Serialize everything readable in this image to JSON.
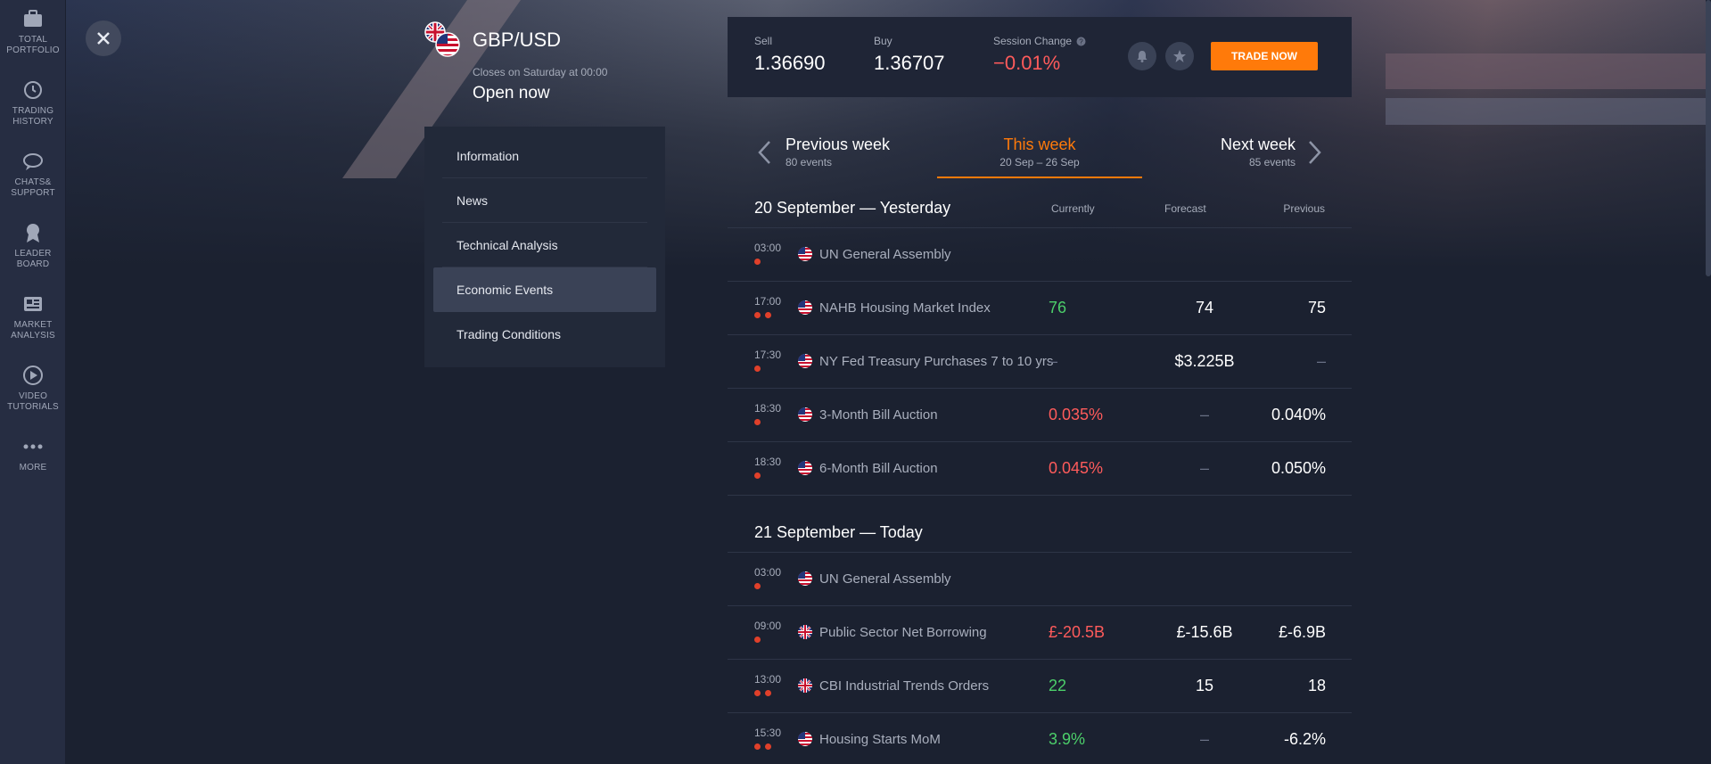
{
  "sidebar": {
    "items": [
      {
        "label": "TOTAL\nPORTFOLIO",
        "icon": "briefcase-icon"
      },
      {
        "label": "TRADING\nHISTORY",
        "icon": "history-icon"
      },
      {
        "label": "CHATS&\nSUPPORT",
        "icon": "chat-icon"
      },
      {
        "label": "LEADER\nBOARD",
        "icon": "medal-icon"
      },
      {
        "label": "MARKET\nANALYSIS",
        "icon": "newspaper-icon"
      },
      {
        "label": "VIDEO\nTUTORIALS",
        "icon": "play-icon"
      },
      {
        "label": "MORE",
        "icon": "more-dots-icon"
      }
    ]
  },
  "asset": {
    "name": "GBP/USD",
    "closes": "Closes on Saturday at 00:00",
    "status": "Open now"
  },
  "prices": {
    "sell_label": "Sell",
    "sell_value": "1.36690",
    "buy_label": "Buy",
    "buy_value": "1.36707",
    "change_label": "Session Change",
    "change_value": "−0.01%",
    "trade_label": "TRADE NOW"
  },
  "menu": {
    "items": [
      "Information",
      "News",
      "Technical Analysis",
      "Economic Events",
      "Trading Conditions"
    ],
    "active": "Economic Events"
  },
  "week_nav": {
    "prev_title": "Previous week",
    "prev_sub": "80 events",
    "this_title": "This week",
    "this_sub": "20 Sep – 26 Sep",
    "next_title": "Next week",
    "next_sub": "85 events"
  },
  "columns": {
    "currently": "Currently",
    "forecast": "Forecast",
    "previous": "Previous"
  },
  "days": [
    {
      "title": "20 September — Yesterday",
      "events": [
        {
          "time": "03:00",
          "importance": 1,
          "country": "US",
          "name": "UN General Assembly",
          "currently": "",
          "forecast": "",
          "previous": "",
          "trend": ""
        },
        {
          "time": "17:00",
          "importance": 2,
          "country": "US",
          "name": "NAHB Housing Market Index",
          "currently": "76",
          "forecast": "74",
          "previous": "75",
          "trend": "pos"
        },
        {
          "time": "17:30",
          "importance": 1,
          "country": "US",
          "name": "NY Fed Treasury Purchases 7 to 10 yrs",
          "currently": "–",
          "forecast": "$3.225B",
          "previous": "–",
          "trend": ""
        },
        {
          "time": "18:30",
          "importance": 1,
          "country": "US",
          "name": "3-Month Bill Auction",
          "currently": "0.035%",
          "forecast": "–",
          "previous": "0.040%",
          "trend": "neg"
        },
        {
          "time": "18:30",
          "importance": 1,
          "country": "US",
          "name": "6-Month Bill Auction",
          "currently": "0.045%",
          "forecast": "–",
          "previous": "0.050%",
          "trend": "neg"
        }
      ]
    },
    {
      "title": "21 September — Today",
      "events": [
        {
          "time": "03:00",
          "importance": 1,
          "country": "US",
          "name": "UN General Assembly",
          "currently": "",
          "forecast": "",
          "previous": "",
          "trend": ""
        },
        {
          "time": "09:00",
          "importance": 1,
          "country": "UK",
          "name": "Public Sector Net Borrowing",
          "currently": "£-20.5B",
          "forecast": "£-15.6B",
          "previous": "£-6.9B",
          "trend": "neg"
        },
        {
          "time": "13:00",
          "importance": 2,
          "country": "UK",
          "name": "CBI Industrial Trends Orders",
          "currently": "22",
          "forecast": "15",
          "previous": "18",
          "trend": "pos"
        },
        {
          "time": "15:30",
          "importance": 2,
          "country": "US",
          "name": "Housing Starts MoM",
          "currently": "3.9%",
          "forecast": "–",
          "previous": "-6.2%",
          "trend": "pos"
        }
      ]
    }
  ]
}
